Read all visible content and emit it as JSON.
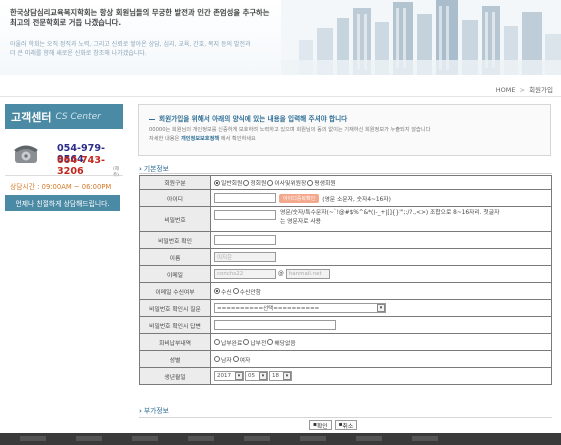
{
  "header": {
    "title_line1": "한국상담심리교육복지학회는 항상 회원님들의  무궁한 발전과 인간 존엄성을 추구하는",
    "title_line2": "최고의 전문학회로 거듭 나겠습니다.",
    "desc_line1": "아울러 학회는 오직 정직과 노력, 그리고 신뢰로 쌓아온 상담, 심리, 교육, 간호, 복지 등의 발전과",
    "desc_line2": "더 큰 미래를 향해 새로운 신화로 창조해 나가겠습니다."
  },
  "breadcrumb": {
    "home": "HOME",
    "sep": ">",
    "current": "회원가입"
  },
  "sidebar": {
    "cs_title": "고객센터",
    "cs_eng": "CS Center",
    "phone1": "054-979-9564",
    "phone2": "064-743-3206",
    "phone2_note": "(제주)",
    "hours": "상담시간 : 09:00AM ~ 06:00PM",
    "consult_button": "언제나 친절하게 상담해드립니다."
  },
  "notice": {
    "heading": "회원가입을 위해서 아래의 양식에 있는 내용을 입력해 주셔야 합니다",
    "line1": "00000는 회원님의 개인정보를 신중하게 보호하려 노력하고 있으며 회원님의 동의 없이는 기재하신 회원정보가 누출되지 않습니다",
    "line2_pre": "자세한 내용은 ",
    "line2_link": "개인정보보호정책",
    "line2_post": " 에서 확인하세요"
  },
  "sections": {
    "basic": "기본정보",
    "extra": "부가정보"
  },
  "form": {
    "member_type_label": "회원구분",
    "member_types": [
      "일반회원",
      "정회원",
      "이사및위원장",
      "평생회원"
    ],
    "userid_label": "아이디",
    "userid_check_button": "아이디중복확인",
    "userid_hint": "(영문 소문자, 숫자4~16자)",
    "password_label": "비밀번호",
    "password_hint_line1": "영문/숫자/특수문자(~`!@#$%^&*()-_+|[]{}'\";:/?.,<>) 조합으로 8~16자리. 첫글자",
    "password_hint_line2": "는 영문자로 사용",
    "password_confirm_label": "비밀번호 확인",
    "name_label": "이름",
    "name_value": "이지은",
    "email_label": "이메일",
    "email_id": "conchs22",
    "email_at": "@",
    "email_domain": "hanmail.net",
    "email_receive_label": "이메일 수신여부",
    "email_receive_options": [
      "수신",
      "수신안함"
    ],
    "pw_question_label": "비밀번호 확인시 질문",
    "pw_question_select": "==========선택==========",
    "pw_answer_label": "비밀번호 확인시 답변",
    "fee_label": "회비납부내역",
    "fee_options": [
      "납부완료",
      "납부전",
      "해당없음"
    ],
    "gender_label": "성별",
    "gender_options": [
      "남자",
      "여자"
    ],
    "birth_label": "생년월일",
    "birth_year": "2017",
    "birth_month": "05",
    "birth_day": "18"
  },
  "buttons": {
    "confirm": "확인",
    "cancel": "취소"
  }
}
